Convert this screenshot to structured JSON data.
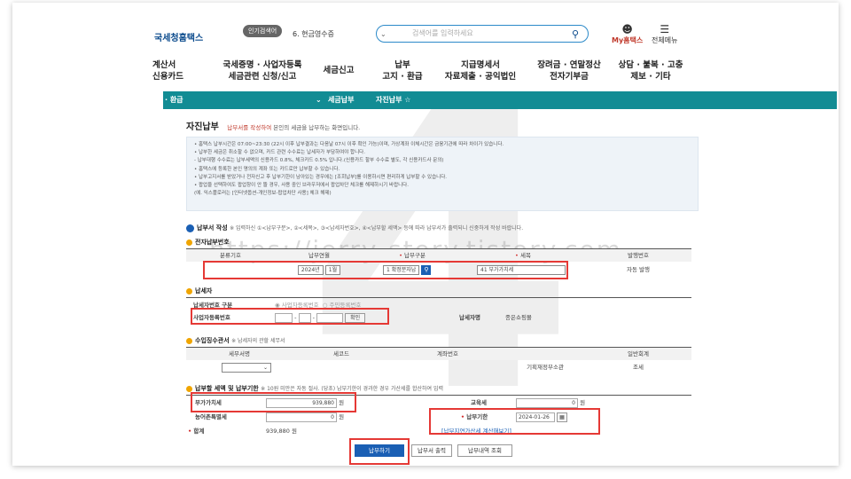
{
  "header": {
    "logo": "국세청홈택스",
    "popular_search_pill": "인기검색어",
    "popular_search_item": "6.  현금영수증",
    "search_placeholder": "검색어를 입력하세요",
    "mytax_label": "My홈택스",
    "all_menu_label": "전체메뉴"
  },
  "gnb": [
    {
      "line1": "계산서",
      "line2": "신용카드"
    },
    {
      "line1": "국세증명 · 사업자등록",
      "line2": "세금관련 신청/신고"
    },
    {
      "line1": "세금신고",
      "line2": ""
    },
    {
      "line1": "납부",
      "line2": "고지 · 환급"
    },
    {
      "line1": "지급명세서",
      "line2": "자료제출 · 공익법인"
    },
    {
      "line1": "장려금 · 연말정산",
      "line2": "전자기부금"
    },
    {
      "line1": "상담 · 불복 · 고충",
      "line2": "제보 · 기타"
    }
  ],
  "navbar": {
    "item1": "· 환급",
    "item2": "세금납부",
    "item3": "자진납부 ☆"
  },
  "page": {
    "title": "자진납부",
    "title_desc_red": "납부서를 작성하여",
    "title_desc_rest": "본인의 세금을 납부하는 화면입니다."
  },
  "notes": [
    "• 홈택스 납부시간은 07:00~23:30 (22시 이후 납부결과는 다음날 07시 이후 확인 가능)이며, 가상계좌 이체시간은 금융기관에 따라 차이가 있습니다.",
    "• 납부한 세금은 취소할 수 없으며, 카드 관련 수수료는 납세자가 부담하여야 합니다.",
    "   - 납부대행 수수료는 납부세액의 신용카드 0.8%, 체크카드 0.5% 입니다.(신용카드 할부 수수료 별도, 각 신용카드사 문의)",
    "• 홈택스에 등록한 본인 명의의 계좌 또는 카드로만 납부할 수 있습니다.",
    "• 납부고지서를 받았거나 전자신고 후 납부기한이 남아있는 경우에는 [조회납부]를 이용하시면 편리하게  납부할 수 있습니다.",
    "• 팝업을 선택하여도 팝업창이 안 뜰 경우, 사용 중인 브라우저에서 팝업차단 체크를 해제하시기 바랍니다.",
    "   (예. 익스플로러는 [인터넷옵션-개인정보-팝업차단 사용] 체크 해제)"
  ],
  "form": {
    "section_title": "납부서 작성",
    "section_desc": "※ 입력하신 ①<납부구분>, ②<세목>, ③<납세자번호>, ④<납부할 세액> 등에 따라 납부서가 출력되니 신중하게 작성 바랍니다.",
    "e_payment": {
      "title": "전자납부번호",
      "headers": [
        "분류기호",
        "납부연월",
        "납부구분",
        "세목",
        "발행번호"
      ],
      "year": "2024년",
      "month": "1월",
      "payment_type": "1 확정분자납",
      "tax_item": "41 부가가치세",
      "issue_no": "자동 발행"
    },
    "taxpayer": {
      "title": "납세자",
      "id_type_label": "납세자번호 구분",
      "radio1": "사업자등록번호",
      "radio2": "주민등록번호",
      "brn_label": "사업자등록번호",
      "dash": "-",
      "confirm_button": "확인",
      "name_label": "납세자명",
      "name_value": "종은쇼핑몰"
    },
    "revenue": {
      "title": "수입징수관서",
      "title_desc": "※ 납세자의 관할 세무서",
      "headers": [
        "세무서명",
        "세코드",
        "계좌번호",
        "회계연도",
        "일반회계"
      ],
      "account_label": "기획재정부소관",
      "account_value": "조세"
    },
    "amount": {
      "title": "납부할 세액 및 납부기한",
      "title_desc": "※ 10원 미만은 자동 절사. (당초) 납부기한이 경과한 경우 가산세를 합산하여 입력",
      "vat_label": "부가가치세",
      "vat_value": "939,880",
      "edu_label": "교육세",
      "edu_value": "0",
      "rural_label": "농어촌특별세",
      "rural_value": "0",
      "due_label": "납부기한",
      "due_value": "2024-01-26",
      "total_label": "합계",
      "total_value": "939,880",
      "won": "원",
      "calc_link": "[납부지연가산세 계산해보기]"
    },
    "buttons": {
      "pay": "납부하기",
      "print": "납부서 출력",
      "history": "납부내역 조회"
    }
  },
  "watermark": {
    "big": "4",
    "url": "https://jerry-story.tistory.com"
  }
}
